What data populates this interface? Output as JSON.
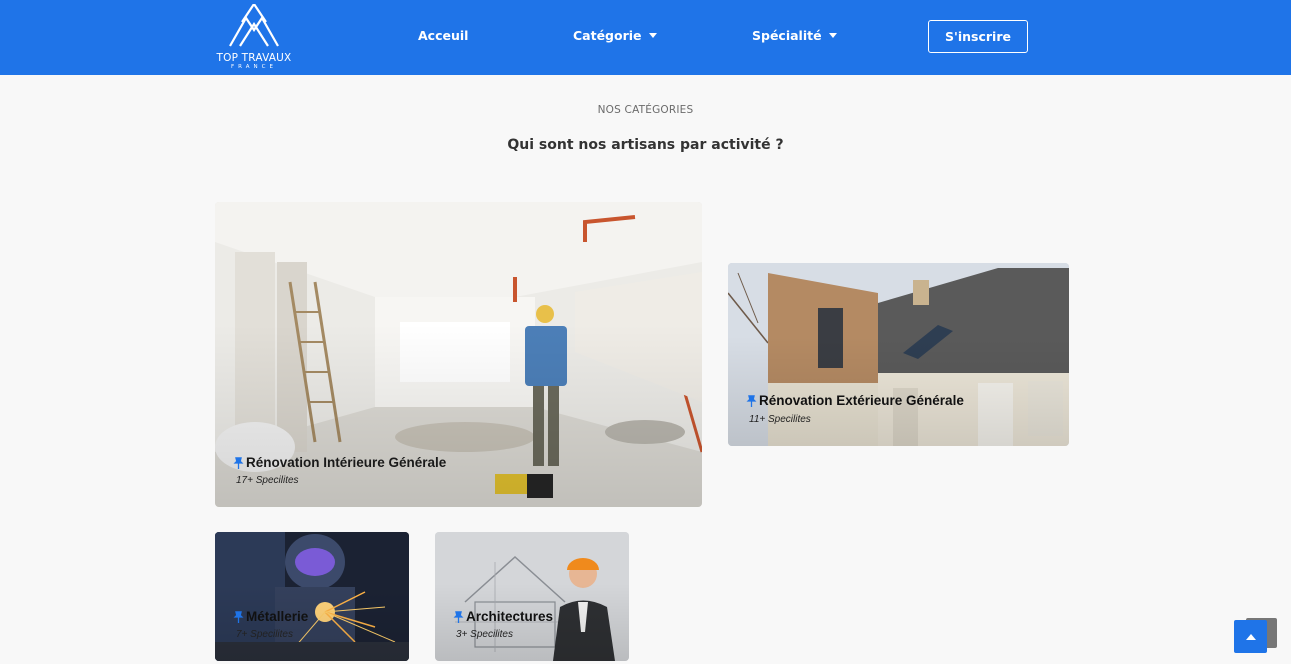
{
  "brand": {
    "name": "TOP TRAVAUX",
    "tagline": "FRANCE"
  },
  "nav": {
    "home": "Acceuil",
    "category": "Catégorie",
    "specialty": "Spécialité",
    "signup": "S'inscrire"
  },
  "section": {
    "eyebrow": "NOS CATÉGORIES",
    "title": "Qui sont nos artisans par activité ?"
  },
  "categories": [
    {
      "title": "Rénovation Intérieure Générale",
      "count": "17+ Specilites",
      "icon": "pin-icon"
    },
    {
      "title": "Rénovation Extérieure Générale",
      "count": "11+ Specilites",
      "icon": "pin-icon"
    },
    {
      "title": "Métallerie",
      "count": "7+ Specilites",
      "icon": "pin-icon"
    },
    {
      "title": "Architectures",
      "count": "3+ Specilites",
      "icon": "pin-icon"
    }
  ],
  "colors": {
    "primary": "#1f74e8",
    "background": "#f8f8f8",
    "scroll_shadow": "#777777"
  },
  "scroll_top": {
    "icon": "arrow-up-icon"
  }
}
